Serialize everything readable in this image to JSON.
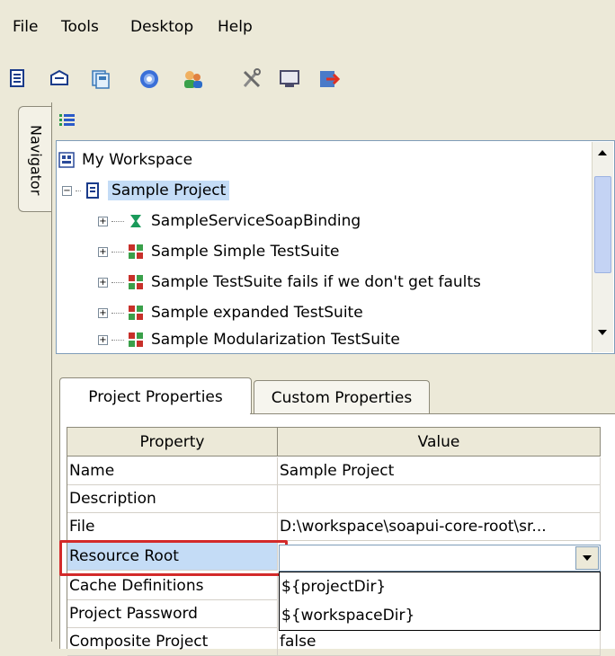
{
  "menu": {
    "items": [
      {
        "label": "File"
      },
      {
        "label": "Tools"
      },
      {
        "label": "Desktop"
      },
      {
        "label": "Help"
      }
    ]
  },
  "toolbar": {
    "buttons": [
      {
        "icon": "new-project-icon"
      },
      {
        "icon": "import-project-icon"
      },
      {
        "icon": "save-all-icon"
      },
      {
        "icon": "help-icon"
      },
      {
        "icon": "users-icon"
      },
      {
        "icon": "tools-icon"
      },
      {
        "icon": "monitor-icon"
      },
      {
        "icon": "exit-icon"
      }
    ]
  },
  "navigator": {
    "tab_label": "Navigator"
  },
  "tree": {
    "workspace": "My Workspace",
    "project": "Sample Project",
    "children": [
      {
        "label": "SampleServiceSoapBinding",
        "icon": "interface-icon"
      },
      {
        "label": "Sample Simple TestSuite",
        "icon": "testsuite-icon"
      },
      {
        "label": "Sample TestSuite fails if we don't get faults",
        "icon": "testsuite-icon"
      },
      {
        "label": "Sample expanded TestSuite",
        "icon": "testsuite-icon"
      },
      {
        "label": "Sample Modularization TestSuite",
        "icon": "testsuite-icon"
      }
    ]
  },
  "properties": {
    "tabs": [
      {
        "label": "Project Properties"
      },
      {
        "label": "Custom Properties"
      }
    ],
    "columns": [
      "Property",
      "Value"
    ],
    "rows": [
      {
        "name": "Name",
        "value": "Sample Project"
      },
      {
        "name": "Description",
        "value": ""
      },
      {
        "name": "File",
        "value": "D:\\workspace\\soapui-core-root\\sr..."
      },
      {
        "name": "Resource Root",
        "value": ""
      },
      {
        "name": "Cache Definitions",
        "value": ""
      },
      {
        "name": "Project Password",
        "value": ""
      },
      {
        "name": "Composite Project",
        "value": "false"
      }
    ],
    "dropdown_options": [
      "${projectDir}",
      "${workspaceDir}"
    ]
  },
  "colors": {
    "highlight": "#d32a2a",
    "selection": "#c4dcf6"
  }
}
